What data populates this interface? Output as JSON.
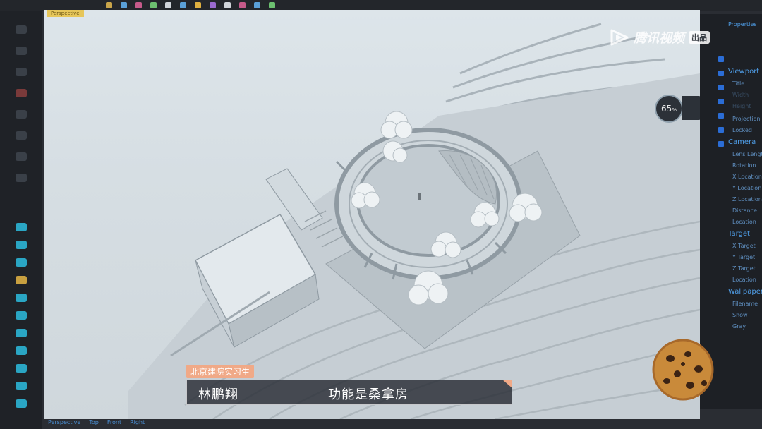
{
  "watermark": {
    "brand": "腾讯视频",
    "badge": "出品"
  },
  "viewport": {
    "tab_label": "Perspective",
    "bottom_tabs": [
      "Perspective",
      "Top",
      "Front",
      "Right"
    ]
  },
  "nav_gauge": {
    "value": "65",
    "unit": "%"
  },
  "properties_panel": {
    "title": "Properties",
    "sections": [
      {
        "header": "Viewport",
        "items": [
          "Title",
          "Width",
          "Height",
          "Projection",
          "Locked"
        ]
      },
      {
        "header": "Camera",
        "items": [
          "Lens Length",
          "Rotation",
          "X Location",
          "Y Location",
          "Z Location",
          "Distance",
          "Location"
        ]
      },
      {
        "header": "Target",
        "items": [
          "X Target",
          "Y Target",
          "Z Target",
          "Location"
        ]
      },
      {
        "header": "Wallpaper",
        "items": [
          "Filename",
          "Show",
          "Gray"
        ]
      }
    ]
  },
  "caption": {
    "tag": "北京建院实习生",
    "name": "林鹏翔",
    "text": "功能是桑拿房"
  },
  "colors": {
    "accent_blue": "#2b6dd6",
    "caption_tag": "#f0a987",
    "viewport_bg": "#d6dee3"
  }
}
